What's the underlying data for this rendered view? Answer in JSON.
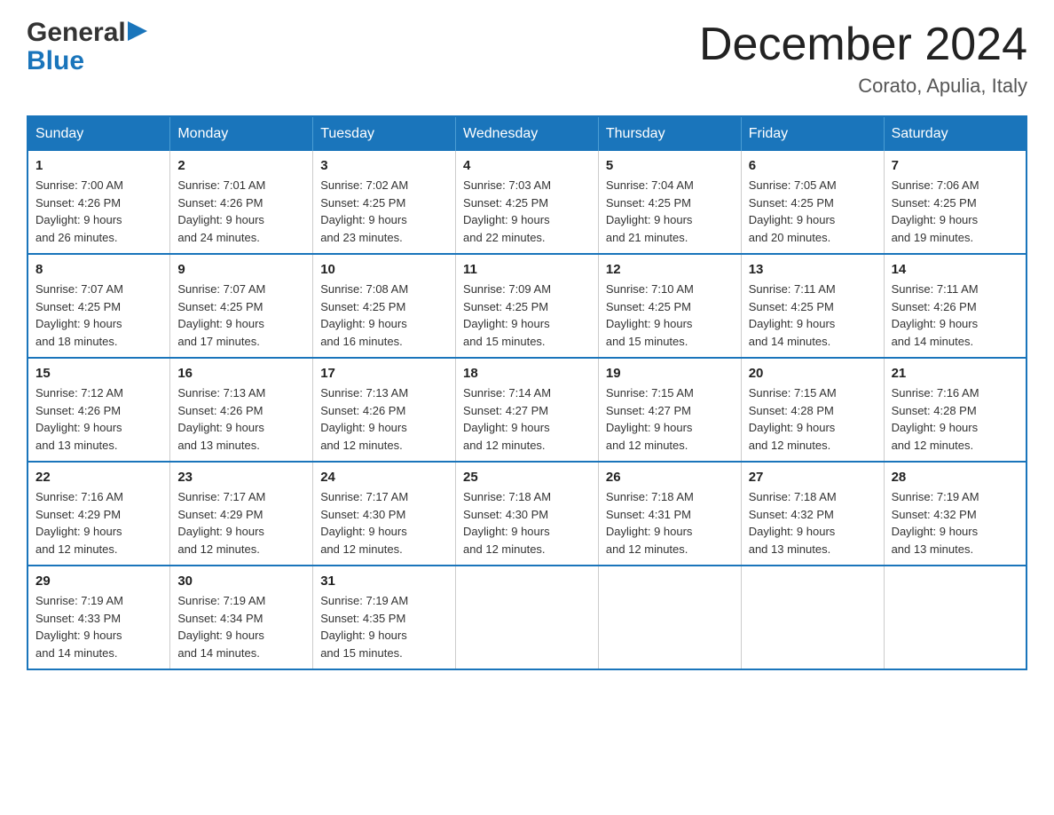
{
  "logo": {
    "word1": "General",
    "word2": "Blue"
  },
  "header": {
    "month": "December 2024",
    "location": "Corato, Apulia, Italy"
  },
  "days_of_week": [
    "Sunday",
    "Monday",
    "Tuesday",
    "Wednesday",
    "Thursday",
    "Friday",
    "Saturday"
  ],
  "weeks": [
    [
      {
        "day": "1",
        "sunrise": "7:00 AM",
        "sunset": "4:26 PM",
        "daylight": "9 hours and 26 minutes."
      },
      {
        "day": "2",
        "sunrise": "7:01 AM",
        "sunset": "4:26 PM",
        "daylight": "9 hours and 24 minutes."
      },
      {
        "day": "3",
        "sunrise": "7:02 AM",
        "sunset": "4:25 PM",
        "daylight": "9 hours and 23 minutes."
      },
      {
        "day": "4",
        "sunrise": "7:03 AM",
        "sunset": "4:25 PM",
        "daylight": "9 hours and 22 minutes."
      },
      {
        "day": "5",
        "sunrise": "7:04 AM",
        "sunset": "4:25 PM",
        "daylight": "9 hours and 21 minutes."
      },
      {
        "day": "6",
        "sunrise": "7:05 AM",
        "sunset": "4:25 PM",
        "daylight": "9 hours and 20 minutes."
      },
      {
        "day": "7",
        "sunrise": "7:06 AM",
        "sunset": "4:25 PM",
        "daylight": "9 hours and 19 minutes."
      }
    ],
    [
      {
        "day": "8",
        "sunrise": "7:07 AM",
        "sunset": "4:25 PM",
        "daylight": "9 hours and 18 minutes."
      },
      {
        "day": "9",
        "sunrise": "7:07 AM",
        "sunset": "4:25 PM",
        "daylight": "9 hours and 17 minutes."
      },
      {
        "day": "10",
        "sunrise": "7:08 AM",
        "sunset": "4:25 PM",
        "daylight": "9 hours and 16 minutes."
      },
      {
        "day": "11",
        "sunrise": "7:09 AM",
        "sunset": "4:25 PM",
        "daylight": "9 hours and 15 minutes."
      },
      {
        "day": "12",
        "sunrise": "7:10 AM",
        "sunset": "4:25 PM",
        "daylight": "9 hours and 15 minutes."
      },
      {
        "day": "13",
        "sunrise": "7:11 AM",
        "sunset": "4:25 PM",
        "daylight": "9 hours and 14 minutes."
      },
      {
        "day": "14",
        "sunrise": "7:11 AM",
        "sunset": "4:26 PM",
        "daylight": "9 hours and 14 minutes."
      }
    ],
    [
      {
        "day": "15",
        "sunrise": "7:12 AM",
        "sunset": "4:26 PM",
        "daylight": "9 hours and 13 minutes."
      },
      {
        "day": "16",
        "sunrise": "7:13 AM",
        "sunset": "4:26 PM",
        "daylight": "9 hours and 13 minutes."
      },
      {
        "day": "17",
        "sunrise": "7:13 AM",
        "sunset": "4:26 PM",
        "daylight": "9 hours and 12 minutes."
      },
      {
        "day": "18",
        "sunrise": "7:14 AM",
        "sunset": "4:27 PM",
        "daylight": "9 hours and 12 minutes."
      },
      {
        "day": "19",
        "sunrise": "7:15 AM",
        "sunset": "4:27 PM",
        "daylight": "9 hours and 12 minutes."
      },
      {
        "day": "20",
        "sunrise": "7:15 AM",
        "sunset": "4:28 PM",
        "daylight": "9 hours and 12 minutes."
      },
      {
        "day": "21",
        "sunrise": "7:16 AM",
        "sunset": "4:28 PM",
        "daylight": "9 hours and 12 minutes."
      }
    ],
    [
      {
        "day": "22",
        "sunrise": "7:16 AM",
        "sunset": "4:29 PM",
        "daylight": "9 hours and 12 minutes."
      },
      {
        "day": "23",
        "sunrise": "7:17 AM",
        "sunset": "4:29 PM",
        "daylight": "9 hours and 12 minutes."
      },
      {
        "day": "24",
        "sunrise": "7:17 AM",
        "sunset": "4:30 PM",
        "daylight": "9 hours and 12 minutes."
      },
      {
        "day": "25",
        "sunrise": "7:18 AM",
        "sunset": "4:30 PM",
        "daylight": "9 hours and 12 minutes."
      },
      {
        "day": "26",
        "sunrise": "7:18 AM",
        "sunset": "4:31 PM",
        "daylight": "9 hours and 12 minutes."
      },
      {
        "day": "27",
        "sunrise": "7:18 AM",
        "sunset": "4:32 PM",
        "daylight": "9 hours and 13 minutes."
      },
      {
        "day": "28",
        "sunrise": "7:19 AM",
        "sunset": "4:32 PM",
        "daylight": "9 hours and 13 minutes."
      }
    ],
    [
      {
        "day": "29",
        "sunrise": "7:19 AM",
        "sunset": "4:33 PM",
        "daylight": "9 hours and 14 minutes."
      },
      {
        "day": "30",
        "sunrise": "7:19 AM",
        "sunset": "4:34 PM",
        "daylight": "9 hours and 14 minutes."
      },
      {
        "day": "31",
        "sunrise": "7:19 AM",
        "sunset": "4:35 PM",
        "daylight": "9 hours and 15 minutes."
      },
      null,
      null,
      null,
      null
    ]
  ],
  "labels": {
    "sunrise": "Sunrise:",
    "sunset": "Sunset:",
    "daylight": "Daylight:"
  }
}
